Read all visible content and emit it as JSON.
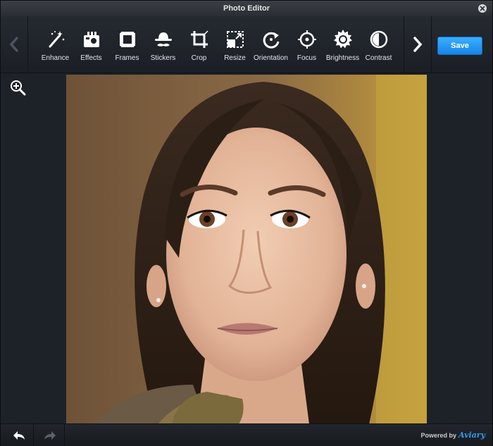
{
  "window": {
    "title": "Photo Editor"
  },
  "toolbar": {
    "tools": [
      {
        "label": "Enhance",
        "icon": "magic-wand-icon"
      },
      {
        "label": "Effects",
        "icon": "effects-icon"
      },
      {
        "label": "Frames",
        "icon": "frame-icon"
      },
      {
        "label": "Stickers",
        "icon": "sticker-hat-icon"
      },
      {
        "label": "Crop",
        "icon": "crop-icon"
      },
      {
        "label": "Resize",
        "icon": "resize-icon"
      },
      {
        "label": "Orientation",
        "icon": "rotate-icon"
      },
      {
        "label": "Focus",
        "icon": "focus-icon"
      },
      {
        "label": "Brightness",
        "icon": "brightness-icon"
      },
      {
        "label": "Contrast",
        "icon": "contrast-icon"
      }
    ],
    "save_label": "Save"
  },
  "footer": {
    "powered_by": "Powered by",
    "brand": "Aviary"
  },
  "colors": {
    "accent": "#1e90f0",
    "background": "#1d2229",
    "text": "#e4e6ea"
  }
}
